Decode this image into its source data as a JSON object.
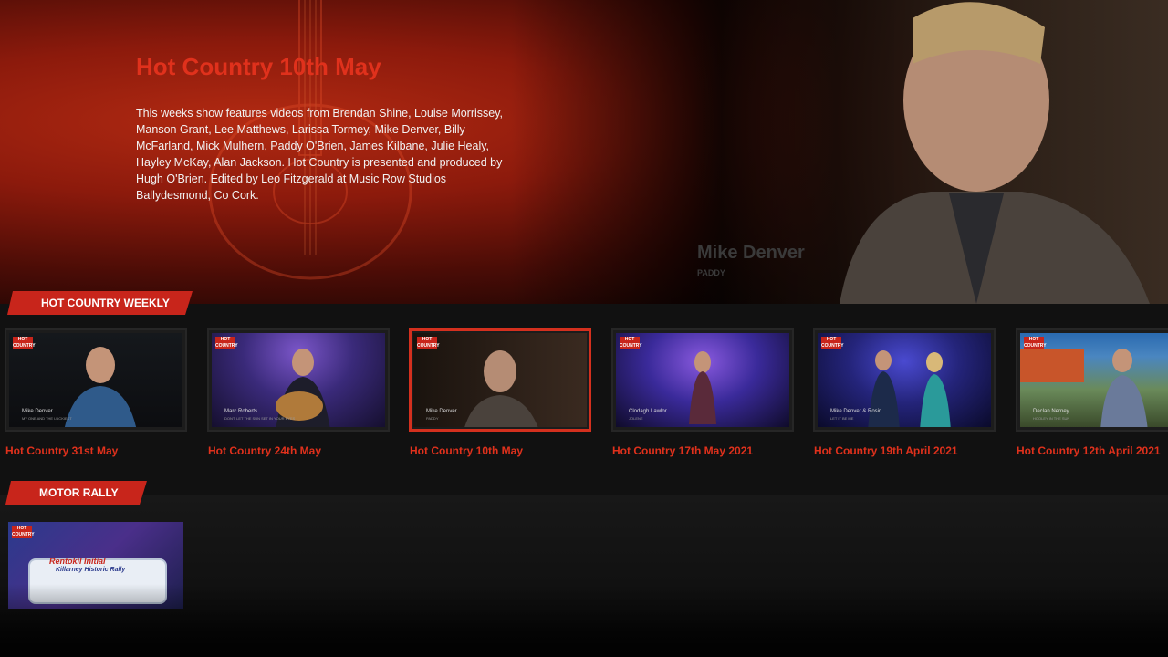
{
  "hero": {
    "title": "Hot Country 10th May",
    "description": "This weeks show features videos from Brendan Shine, Louise Morrissey, Manson Grant, Lee Matthews, Larissa Tormey, Mike Denver, Billy McFarland, Mick Mulhern, Paddy O'Brien, James Kilbane, Julie Healy, Hayley McKay, Alan Jackson. Hot Country is presented and produced by Hugh O'Brien. Edited by Leo Fitzgerald at Music Row Studios Ballydesmond, Co Cork.",
    "caption_name": "Mike Denver",
    "caption_sub": "PADDY"
  },
  "sections": [
    {
      "label": "HOT COUNTRY WEEKLY",
      "items": [
        {
          "title": "Hot Country 31st May",
          "thumb_name": "Mike Denver",
          "thumb_sub": "MY ONE AND THE LUCKIEST",
          "active": false
        },
        {
          "title": "Hot Country 24th May",
          "thumb_name": "Marc Roberts",
          "thumb_sub": "DON'T LET THE SUN SET IN YOUR EYES",
          "active": false
        },
        {
          "title": "Hot Country 10th May",
          "thumb_name": "Mike Denver",
          "thumb_sub": "PADDY",
          "active": true
        },
        {
          "title": "Hot Country 17th May 2021",
          "thumb_name": "Clodagh Lawlor",
          "thumb_sub": "JOLENE",
          "active": false
        },
        {
          "title": "Hot Country 19th April 2021",
          "thumb_name": "Mike Denver & Rosin",
          "thumb_sub": "LET IT BE ME",
          "active": false
        },
        {
          "title": "Hot Country 12th April 2021",
          "thumb_name": "Declan Nerney",
          "thumb_sub": "HOOLEY IN THE SUN",
          "active": false
        }
      ]
    },
    {
      "label": "MOTOR RALLY",
      "items": [
        {
          "title": "",
          "thumb_line1": "Rentokil Initial",
          "thumb_line2": "Killarney Historic Rally"
        }
      ]
    }
  ],
  "logo_text": "HOT COUNTRY",
  "colors": {
    "accent": "#e0311c",
    "tag": "#c8251b"
  }
}
